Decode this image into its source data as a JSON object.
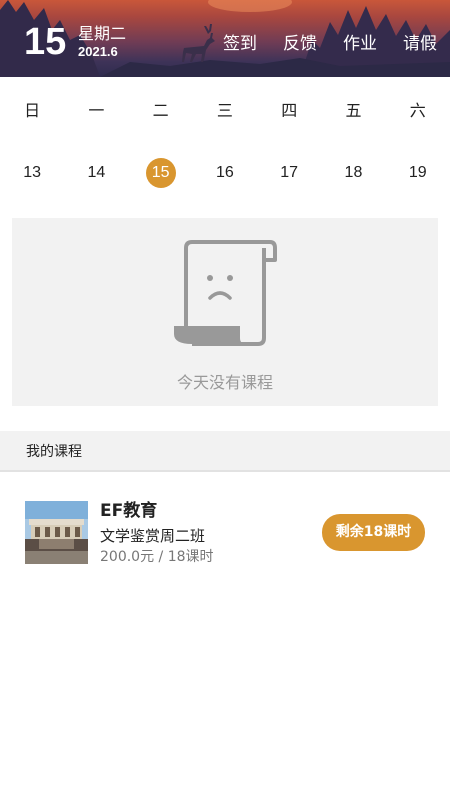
{
  "header": {
    "day": "15",
    "weekday": "星期二",
    "year_month": "2021.6",
    "actions": [
      {
        "label": "签到"
      },
      {
        "label": "反馈"
      },
      {
        "label": "作业"
      },
      {
        "label": "请假"
      }
    ]
  },
  "week": {
    "weekdays": [
      "日",
      "一",
      "二",
      "三",
      "四",
      "五",
      "六"
    ],
    "dates": [
      "13",
      "14",
      "15",
      "16",
      "17",
      "18",
      "19"
    ],
    "selected": "15"
  },
  "empty_state": {
    "icon": "sad-scroll-icon",
    "text": "今天没有课程"
  },
  "section": {
    "title": "我的课程"
  },
  "courses": [
    {
      "org": "EF教育",
      "name": "文学鉴赏周二班",
      "price": "200.0元 / 18课时",
      "badge": "剩余18课时"
    }
  ],
  "colors": {
    "accent": "#d9962f",
    "header_top": "#c9573a",
    "header_bottom": "#2e2b4e",
    "panel_bg": "#f2f2f2"
  }
}
